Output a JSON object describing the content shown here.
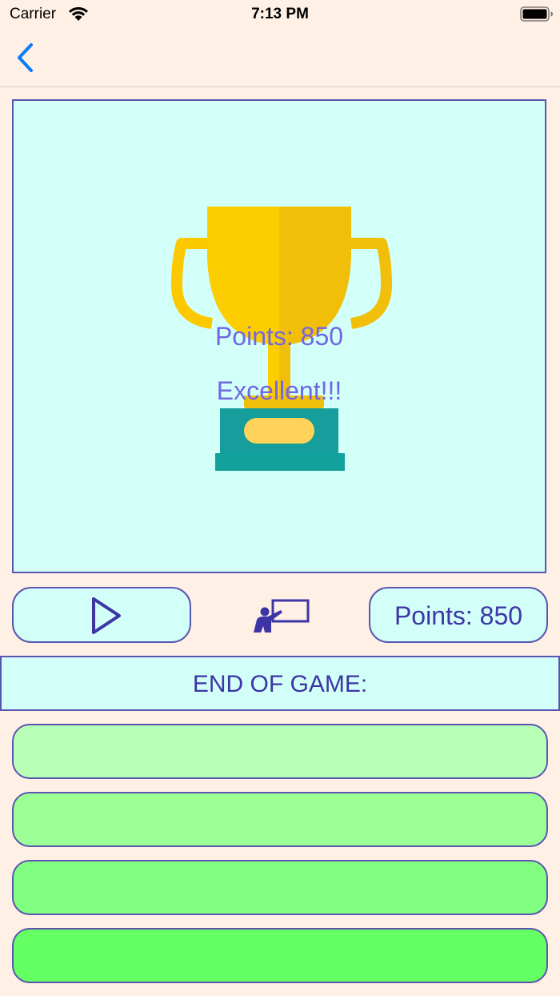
{
  "status_bar": {
    "carrier": "Carrier",
    "time": "7:13 PM",
    "wifi_icon": "wifi-icon",
    "battery_icon": "battery-icon"
  },
  "nav": {
    "back_icon": "chevron-left-icon"
  },
  "result": {
    "points_label": "Points: 850",
    "message": "Excellent!!!",
    "trophy_icon": "trophy-icon"
  },
  "controls": {
    "play_icon": "play-icon",
    "teacher_icon": "teacher-icon",
    "points_label": "Points: 850"
  },
  "end_banner": {
    "text": "END OF GAME:"
  },
  "answers": [
    {
      "label": "",
      "color": "#b8ffb8"
    },
    {
      "label": "",
      "color": "#9bff95"
    },
    {
      "label": "",
      "color": "#80ff80"
    },
    {
      "label": "",
      "color": "#63ff63"
    }
  ],
  "colors": {
    "background": "#fff0e6",
    "panel": "#d2fff8",
    "border": "#5a55b0",
    "text_primary": "#3d35a6",
    "text_accent": "#7066e6",
    "ios_blue": "#0a7aff"
  }
}
